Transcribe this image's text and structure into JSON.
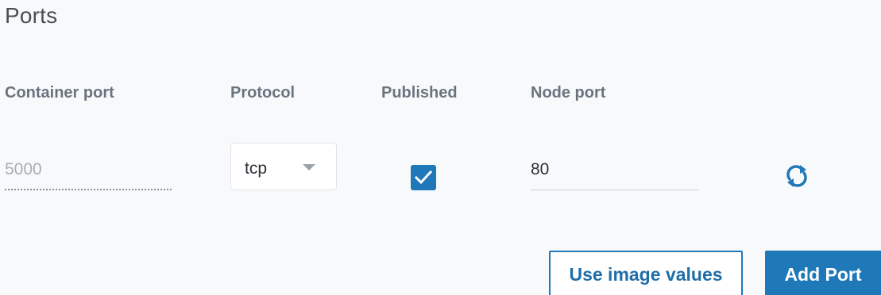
{
  "section": {
    "title": "Ports"
  },
  "columns": {
    "container_port": "Container port",
    "protocol": "Protocol",
    "published": "Published",
    "node_port": "Node port"
  },
  "row": {
    "container_port_value": "5000",
    "protocol_value": "tcp",
    "published_checked": true,
    "node_port_value": "80"
  },
  "actions": {
    "use_image_values": "Use image values",
    "add_port": "Add Port"
  },
  "icons": {
    "refresh": "refresh-icon",
    "dropdown": "chevron-down-icon",
    "check": "check-icon"
  },
  "colors": {
    "accent": "#1f78b8",
    "background": "#f8f9fb",
    "header_text": "#6a747e"
  }
}
